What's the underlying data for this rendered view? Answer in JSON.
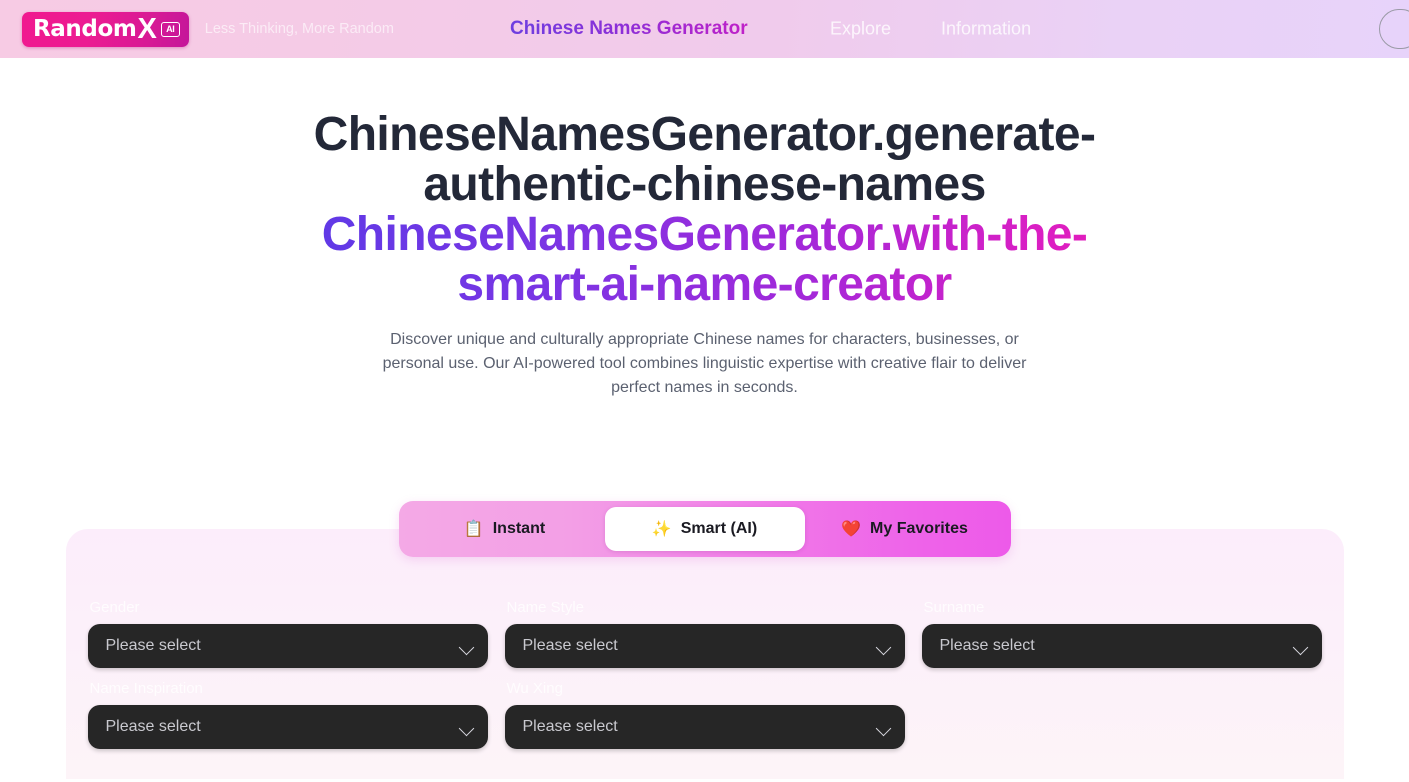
{
  "header": {
    "logo": {
      "word": "Random",
      "x": "X",
      "badge": "AI"
    },
    "tagline": "Less Thinking, More Random",
    "brand_title": "Chinese Names Generator",
    "nav": [
      {
        "label": "Explore"
      },
      {
        "label": "Information"
      }
    ]
  },
  "hero": {
    "title_line1": "ChineseNamesGenerator.generate-",
    "title_line2": "authentic-chinese-names",
    "title_accent_line1": "ChineseNamesGenerator.with-the-",
    "title_accent_line2": "smart-ai-name-creator",
    "description": "Discover unique and culturally appropriate Chinese names for characters, businesses, or personal use. Our AI-powered tool combines linguistic expertise with creative flair to deliver perfect names in seconds."
  },
  "tabs": [
    {
      "label": "Instant",
      "icon": "clipboard-icon",
      "glyph": "📋",
      "active": false
    },
    {
      "label": "Smart (AI)",
      "icon": "sparkles-icon",
      "glyph": "✨",
      "active": true
    },
    {
      "label": "My Favorites",
      "icon": "heart-icon",
      "glyph": "❤️",
      "active": false
    }
  ],
  "form": {
    "fields": [
      {
        "label": "Gender",
        "value": "Please select"
      },
      {
        "label": "Name Style",
        "value": "Please select"
      },
      {
        "label": "Surname",
        "value": "Please select"
      },
      {
        "label": "Name Inspiration",
        "value": "Please select"
      },
      {
        "label": "Wu Xing",
        "value": "Please select"
      }
    ]
  },
  "colors": {
    "brand_pink": "#ec1b92",
    "accent_purple": "#7b35e4",
    "accent_magenta": "#e61bb8",
    "tab_bar": "#f078e8",
    "select_bg": "#262626",
    "title_dark": "#232838"
  }
}
